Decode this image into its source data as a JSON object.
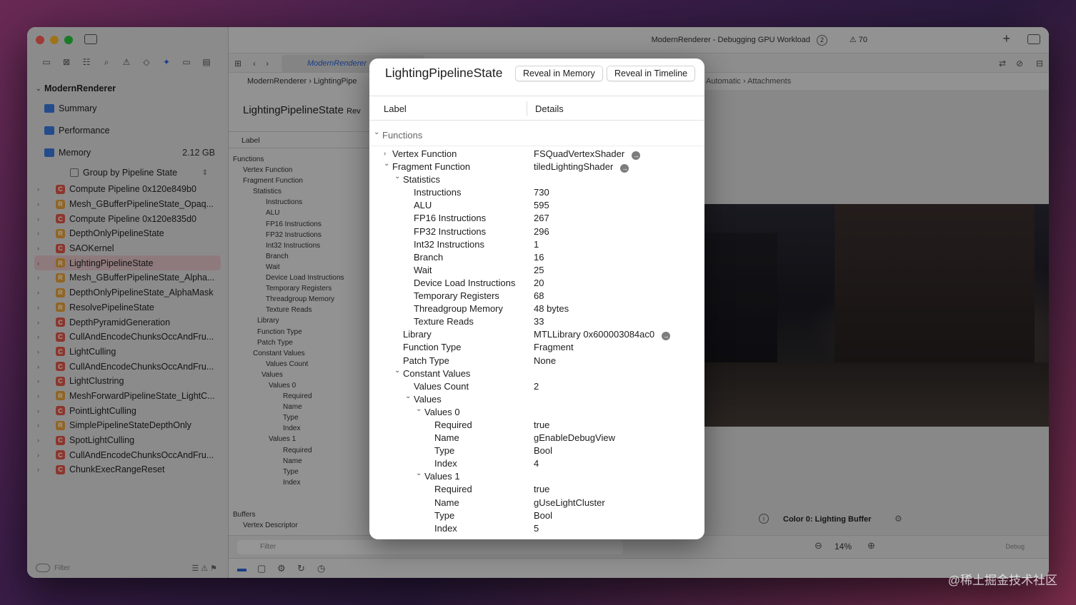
{
  "window": {
    "title": "ModernRenderer - Debugging GPU Workload",
    "issue_count": "2",
    "warning_count": "70"
  },
  "sidebar": {
    "project": "ModernRenderer",
    "sections": [
      {
        "label": "Summary",
        "value": ""
      },
      {
        "label": "Performance",
        "value": ""
      },
      {
        "label": "Memory",
        "value": "2.12 GB"
      }
    ],
    "group_label": "Group by Pipeline State",
    "pipelines": [
      {
        "badge": "C",
        "label": "Compute Pipeline 0x120e849b0"
      },
      {
        "badge": "R",
        "label": "Mesh_GBufferPipelineState_Opaq..."
      },
      {
        "badge": "C",
        "label": "Compute Pipeline 0x120e835d0"
      },
      {
        "badge": "R",
        "label": "DepthOnlyPipelineState"
      },
      {
        "badge": "C",
        "label": "SAOKernel"
      },
      {
        "badge": "R",
        "label": "LightingPipelineState"
      },
      {
        "badge": "R",
        "label": "Mesh_GBufferPipelineState_Alpha..."
      },
      {
        "badge": "R",
        "label": "DepthOnlyPipelineState_AlphaMask"
      },
      {
        "badge": "R",
        "label": "ResolvePipelineState"
      },
      {
        "badge": "C",
        "label": "DepthPyramidGeneration"
      },
      {
        "badge": "C",
        "label": "CullAndEncodeChunksOccAndFru..."
      },
      {
        "badge": "C",
        "label": "LightCulling"
      },
      {
        "badge": "C",
        "label": "CullAndEncodeChunksOccAndFru..."
      },
      {
        "badge": "C",
        "label": "LightClustring"
      },
      {
        "badge": "R",
        "label": "MeshForwardPipelineState_LightC..."
      },
      {
        "badge": "C",
        "label": "PointLightCulling"
      },
      {
        "badge": "R",
        "label": "SimplePipelineStateDepthOnly"
      },
      {
        "badge": "C",
        "label": "SpotLightCulling"
      },
      {
        "badge": "C",
        "label": "CullAndEncodeChunksOccAndFru..."
      },
      {
        "badge": "C",
        "label": "ChunkExecRangeReset"
      }
    ],
    "filter_placeholder": "Filter"
  },
  "editor": {
    "tab_label": "ModernRenderer",
    "breadcrumb_1": "ModernRenderer",
    "breadcrumb_2": "LightingPipe",
    "breadcrumb_right_1": "Automatic",
    "breadcrumb_right_2": "Attachments",
    "detail_title": "LightingPipelineState",
    "detail_title_suffix": "Rev",
    "detail_col": "Label",
    "detail_list": [
      "Functions",
      "Vertex Function",
      "Fragment Function",
      "Statistics",
      "Instructions",
      "ALU",
      "FP16 Instructions",
      "FP32 Instructions",
      "Int32 Instructions",
      "Branch",
      "Wait",
      "Device Load Instructions",
      "Temporary Registers",
      "Threadgroup Memory",
      "Texture Reads",
      "Library",
      "Function Type",
      "Patch Type",
      "Constant Values",
      "Values Count",
      "Values",
      "Values 0",
      "Required",
      "Name",
      "Type",
      "Index",
      "Values 1",
      "Required",
      "Name",
      "Type",
      "Index",
      "",
      "",
      "Buffers",
      "Vertex Descriptor"
    ],
    "viewer_caption": "Color 0: Lighting Buffer",
    "zoom": "14%",
    "debug_label": "Debug",
    "filter_placeholder": "Filter"
  },
  "popover": {
    "title": "LightingPipelineState",
    "btn_memory": "Reveal in Memory",
    "btn_timeline": "Reveal in Timeline",
    "col_label": "Label",
    "col_details": "Details",
    "rows": [
      {
        "label": "Functions",
        "value": "",
        "indent": 0,
        "chev": "open",
        "kind": "section",
        "link": false
      },
      {
        "label": "Vertex Function",
        "value": "FSQuadVertexShader",
        "indent": 1,
        "chev": "closed",
        "link": true
      },
      {
        "label": "Fragment Function",
        "value": "tiledLightingShader",
        "indent": 1,
        "chev": "open",
        "link": true
      },
      {
        "label": "Statistics",
        "value": "",
        "indent": 2,
        "chev": "open",
        "link": false
      },
      {
        "label": "Instructions",
        "value": "730",
        "indent": 3,
        "chev": "",
        "link": false
      },
      {
        "label": "ALU",
        "value": "595",
        "indent": 3,
        "chev": "",
        "link": false
      },
      {
        "label": "FP16 Instructions",
        "value": "267",
        "indent": 3,
        "chev": "",
        "link": false
      },
      {
        "label": "FP32 Instructions",
        "value": "296",
        "indent": 3,
        "chev": "",
        "link": false
      },
      {
        "label": "Int32 Instructions",
        "value": "1",
        "indent": 3,
        "chev": "",
        "link": false
      },
      {
        "label": "Branch",
        "value": "16",
        "indent": 3,
        "chev": "",
        "link": false
      },
      {
        "label": "Wait",
        "value": "25",
        "indent": 3,
        "chev": "",
        "link": false
      },
      {
        "label": "Device Load Instructions",
        "value": "20",
        "indent": 3,
        "chev": "",
        "link": false
      },
      {
        "label": "Temporary Registers",
        "value": "68",
        "indent": 3,
        "chev": "",
        "link": false
      },
      {
        "label": "Threadgroup Memory",
        "value": "48 bytes",
        "indent": 3,
        "chev": "",
        "link": false
      },
      {
        "label": "Texture Reads",
        "value": "33",
        "indent": 3,
        "chev": "",
        "link": false
      },
      {
        "label": "Library",
        "value": "MTLLibrary 0x600003084ac0",
        "indent": 2,
        "chev": "",
        "link": true
      },
      {
        "label": "Function Type",
        "value": "Fragment",
        "indent": 2,
        "chev": "",
        "link": false
      },
      {
        "label": "Patch Type",
        "value": "None",
        "indent": 2,
        "chev": "",
        "link": false
      },
      {
        "label": "Constant Values",
        "value": "",
        "indent": 2,
        "chev": "open",
        "link": false
      },
      {
        "label": "Values Count",
        "value": "2",
        "indent": 3,
        "chev": "",
        "link": false
      },
      {
        "label": "Values",
        "value": "",
        "indent": 3,
        "chev": "open",
        "link": false
      },
      {
        "label": "Values 0",
        "value": "",
        "indent": 4,
        "chev": "open",
        "link": false
      },
      {
        "label": "Required",
        "value": "true",
        "indent": 5,
        "chev": "",
        "link": false
      },
      {
        "label": "Name",
        "value": "gEnableDebugView",
        "indent": 5,
        "chev": "",
        "link": false
      },
      {
        "label": "Type",
        "value": "Bool",
        "indent": 5,
        "chev": "",
        "link": false
      },
      {
        "label": "Index",
        "value": "4",
        "indent": 5,
        "chev": "",
        "link": false
      },
      {
        "label": "Values 1",
        "value": "",
        "indent": 4,
        "chev": "open",
        "link": false
      },
      {
        "label": "Required",
        "value": "true",
        "indent": 5,
        "chev": "",
        "link": false
      },
      {
        "label": "Name",
        "value": "gUseLightCluster",
        "indent": 5,
        "chev": "",
        "link": false
      },
      {
        "label": "Type",
        "value": "Bool",
        "indent": 5,
        "chev": "",
        "link": false
      },
      {
        "label": "Index",
        "value": "5",
        "indent": 5,
        "chev": "",
        "link": false
      }
    ]
  },
  "watermark": "@稀土掘金技术社区"
}
